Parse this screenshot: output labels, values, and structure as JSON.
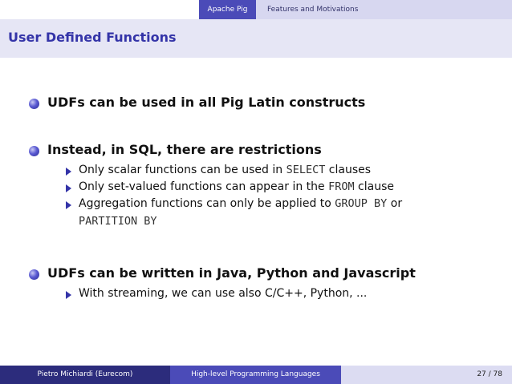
{
  "header": {
    "section_active": "Apache Pig",
    "subsection": "Features and Motivations"
  },
  "slide": {
    "title": "User Defined Functions",
    "items": [
      {
        "text": "UDFs can be used in all Pig Latin constructs"
      },
      {
        "text": "Instead, in SQL, there are restrictions",
        "subitems": [
          {
            "pre": "Only scalar functions can be used in ",
            "code": "SELECT",
            "post": " clauses"
          },
          {
            "pre": "Only set-valued functions can appear in the ",
            "code": "FROM",
            "post": " clause"
          },
          {
            "pre": "Aggregation functions can only be applied to ",
            "code": "GROUP BY",
            "post": " or",
            "line2_code": "PARTITION BY"
          }
        ]
      },
      {
        "text": "UDFs can be written in Java, Python and Javascript",
        "subitems": [
          {
            "text": "With streaming, we can use also C/C++, Python, ..."
          }
        ]
      }
    ]
  },
  "footer": {
    "author": "Pietro Michiardi  (Eurecom)",
    "talk_title": "High-level Programming Languages",
    "page": "27 / 78"
  },
  "colors": {
    "accent": "#3434a8",
    "title_bg": "#e6e6f5",
    "footer_dark": "#2c2c7c",
    "footer_mid": "#4b4bb8",
    "footer_light": "#dcdcf2"
  }
}
